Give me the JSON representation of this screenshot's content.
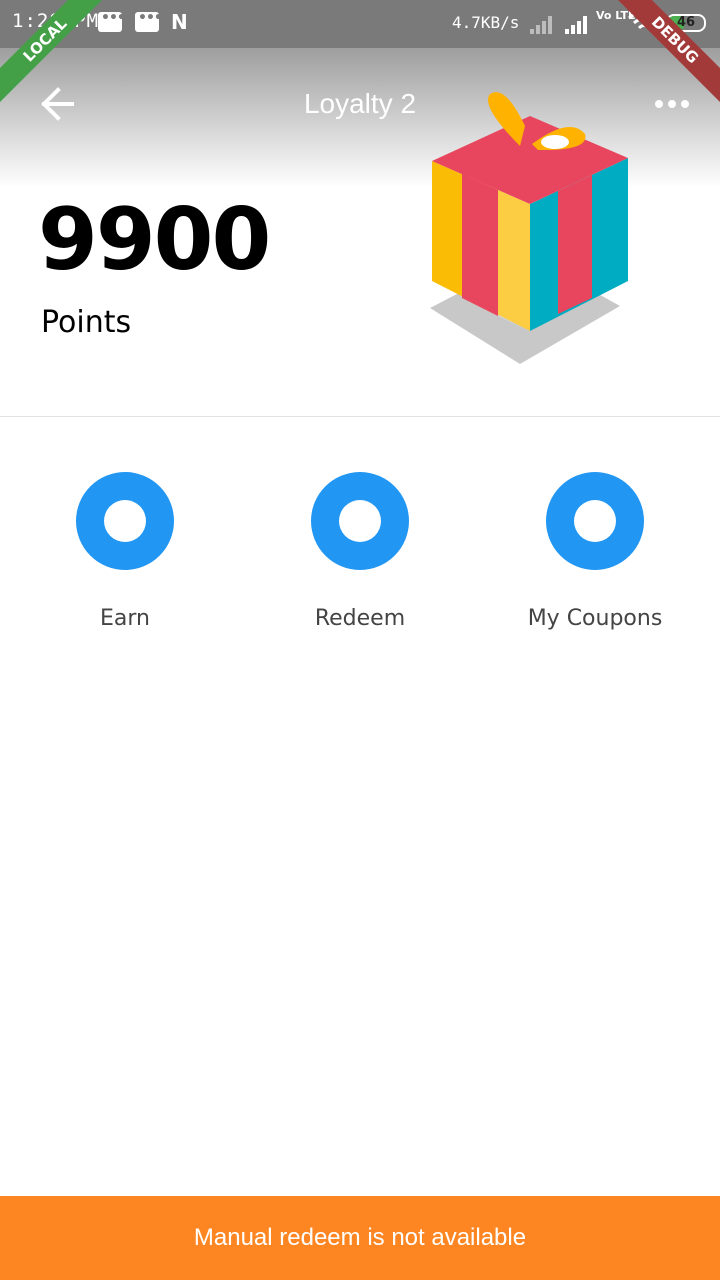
{
  "status_bar": {
    "time": "1:28 PM",
    "network_speed": "4.7KB/s",
    "volte": "Vo LTE",
    "battery": "46"
  },
  "banners": {
    "left": "LOCAL",
    "right": "DEBUG"
  },
  "app_bar": {
    "title": "Loyalty 2",
    "back_icon": "arrow-left-icon",
    "more_icon": "more-horizontal-icon"
  },
  "points": {
    "value": "9900",
    "label": "Points"
  },
  "actions": [
    {
      "label": "Earn",
      "icon": "ring-icon",
      "color": "#2196f3"
    },
    {
      "label": "Redeem",
      "icon": "ring-icon",
      "color": "#2196f3"
    },
    {
      "label": "My Coupons",
      "icon": "ring-icon",
      "color": "#2196f3"
    }
  ],
  "footer": {
    "message": "Manual redeem is not available",
    "color": "#fd8623"
  }
}
